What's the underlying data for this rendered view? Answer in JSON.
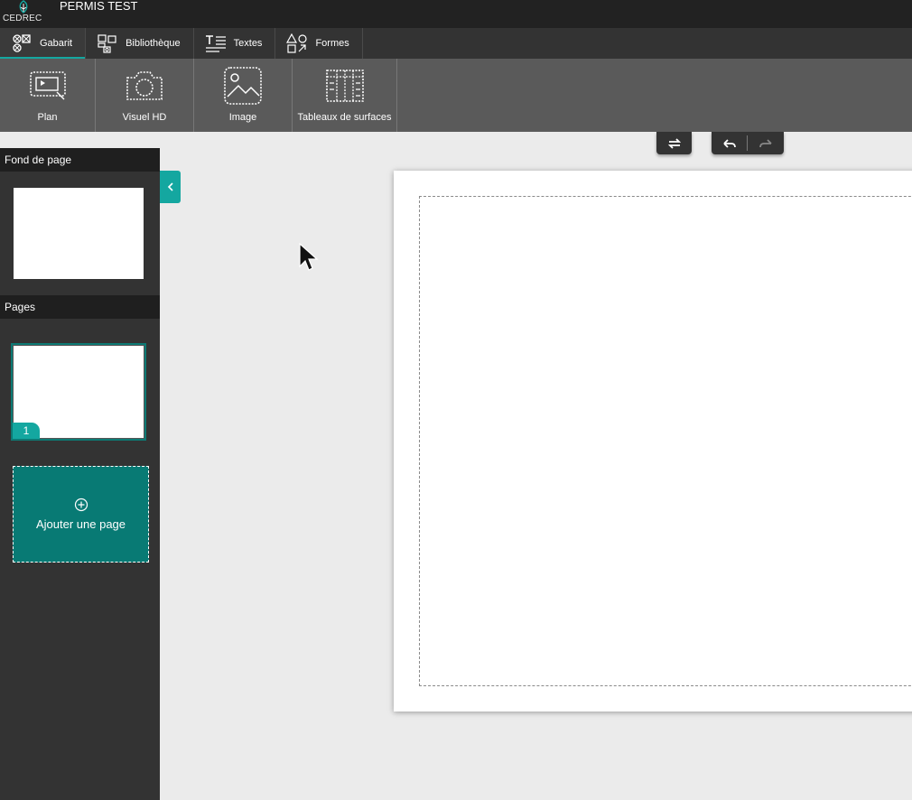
{
  "titlebar": {
    "logo_text": "CEDREC",
    "app_title": "PERMIS TEST"
  },
  "tabs": [
    {
      "label": "Gabarit",
      "icon": "template-icon",
      "active": true
    },
    {
      "label": "Bibliothèque",
      "icon": "library-icon",
      "active": false
    },
    {
      "label": "Textes",
      "icon": "text-icon",
      "active": false
    },
    {
      "label": "Formes",
      "icon": "shapes-icon",
      "active": false
    }
  ],
  "tools": [
    {
      "label": "Plan",
      "icon": "plan-icon"
    },
    {
      "label": "Visuel HD",
      "icon": "camera-icon"
    },
    {
      "label": "Image",
      "icon": "image-icon"
    },
    {
      "label": "Tableaux de surfaces",
      "icon": "table-icon"
    }
  ],
  "sidebar": {
    "background_header": "Fond de page",
    "pages_header": "Pages",
    "pages": [
      {
        "number": "1"
      }
    ],
    "add_page_label": "Ajouter une page"
  },
  "colors": {
    "accent": "#14a7a0",
    "add_page_bg": "#087a74",
    "titlebar_bg": "#222222",
    "tabs_bg": "#333333",
    "ribbon_bg": "#5a5a5a",
    "workspace_bg": "#ebebeb"
  }
}
